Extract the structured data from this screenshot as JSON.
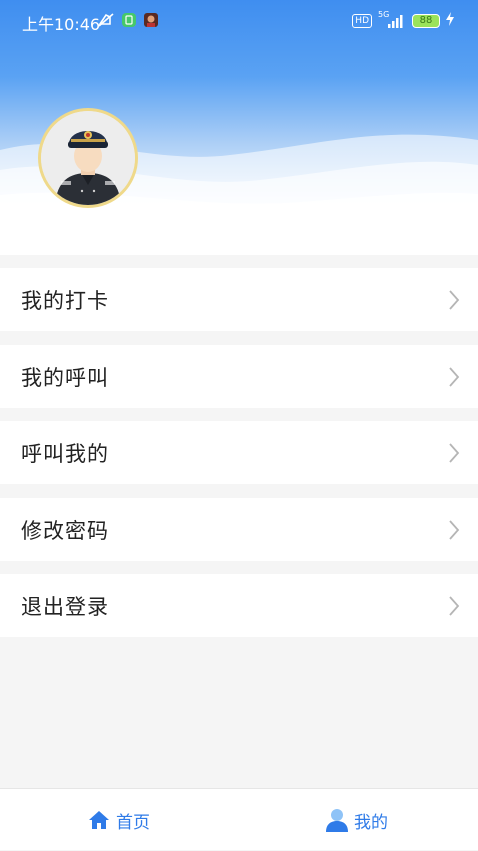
{
  "status_bar": {
    "time": "上午10:46",
    "network_badge": "HD",
    "network_type": "5G",
    "battery_level": "88",
    "icons": [
      "mute-icon",
      "notification-app-icon",
      "notification-avatar-icon",
      "signal-icon",
      "charging-icon"
    ]
  },
  "profile": {
    "avatar_icon": "police-officer-avatar"
  },
  "menu": {
    "items": [
      {
        "label": "我的打卡",
        "icon": "chevron-right-icon"
      },
      {
        "label": "我的呼叫",
        "icon": "chevron-right-icon"
      },
      {
        "label": "呼叫我的",
        "icon": "chevron-right-icon"
      },
      {
        "label": "修改密码",
        "icon": "chevron-right-icon"
      },
      {
        "label": "退出登录",
        "icon": "chevron-right-icon"
      }
    ]
  },
  "tab_bar": {
    "tabs": [
      {
        "label": "首页",
        "icon": "home-icon"
      },
      {
        "label": "我的",
        "icon": "user-icon",
        "active": true
      }
    ]
  },
  "colors": {
    "accent": "#2f7be8",
    "header_blue": "#3f8ef0",
    "background": "#f5f5f5",
    "avatar_border": "#efd98a"
  }
}
